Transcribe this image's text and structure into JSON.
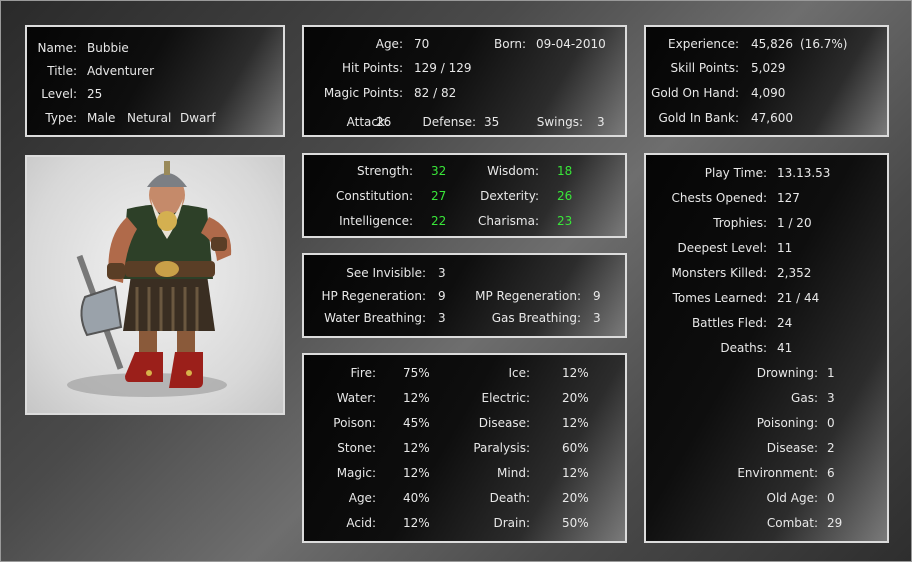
{
  "identity": {
    "name_label": "Name:",
    "name": "Bubbie",
    "title_label": "Title:",
    "title": "Adventurer",
    "level_label": "Level:",
    "level": "25",
    "type_label": "Type:",
    "gender": "Male",
    "alignment": "Netural",
    "race": "Dwarf"
  },
  "vitals": {
    "age_label": "Age:",
    "age": "70",
    "born_label": "Born:",
    "born": "09-04-2010",
    "hp_label": "Hit Points:",
    "hp": "129 / 129",
    "mp_label": "Magic Points:",
    "mp": "82 / 82",
    "attack_label": "Attack:",
    "attack": "26",
    "defense_label": "Defense:",
    "defense": "35",
    "swings_label": "Swings:",
    "swings": "3"
  },
  "wealth": {
    "exp_label": "Experience:",
    "exp": "45,826",
    "exp_pct": "(16.7%)",
    "skill_label": "Skill Points:",
    "skill": "5,029",
    "gold_hand_label": "Gold On Hand:",
    "gold_hand": "4,090",
    "gold_bank_label": "Gold In Bank:",
    "gold_bank": "47,600"
  },
  "attributes": {
    "str_label": "Strength:",
    "str": "32",
    "wis_label": "Wisdom:",
    "wis": "18",
    "con_label": "Constitution:",
    "con": "27",
    "dex_label": "Dexterity:",
    "dex": "26",
    "int_label": "Intelligence:",
    "int": "22",
    "cha_label": "Charisma:",
    "cha": "23"
  },
  "abilities": {
    "see_inv_label": "See Invisible:",
    "see_inv": "3",
    "hp_regen_label": "HP Regeneration:",
    "hp_regen": "9",
    "mp_regen_label": "MP Regeneration:",
    "mp_regen": "9",
    "water_label": "Water Breathing:",
    "water": "3",
    "gas_label": "Gas Breathing:",
    "gas": "3"
  },
  "resistances": {
    "left": [
      {
        "label": "Fire:",
        "value": "75%"
      },
      {
        "label": "Water:",
        "value": "12%"
      },
      {
        "label": "Poison:",
        "value": "45%"
      },
      {
        "label": "Stone:",
        "value": "12%"
      },
      {
        "label": "Magic:",
        "value": "12%"
      },
      {
        "label": "Age:",
        "value": "40%"
      },
      {
        "label": "Acid:",
        "value": "12%"
      }
    ],
    "right": [
      {
        "label": "Ice:",
        "value": "12%"
      },
      {
        "label": "Electric:",
        "value": "20%"
      },
      {
        "label": "Disease:",
        "value": "12%"
      },
      {
        "label": "Paralysis:",
        "value": "60%"
      },
      {
        "label": "Mind:",
        "value": "12%"
      },
      {
        "label": "Death:",
        "value": "20%"
      },
      {
        "label": "Drain:",
        "value": "50%"
      }
    ]
  },
  "statistics": {
    "top": [
      {
        "label": "Play Time:",
        "value": "13.13.53"
      },
      {
        "label": "Chests Opened:",
        "value": "127"
      },
      {
        "label": "Trophies:",
        "value": "1 / 20"
      },
      {
        "label": "Deepest Level:",
        "value": "11"
      },
      {
        "label": "Monsters Killed:",
        "value": "2,352"
      },
      {
        "label": "Tomes Learned:",
        "value": "21 / 44"
      },
      {
        "label": "Battles Fled:",
        "value": "24"
      },
      {
        "label": "Deaths:",
        "value": "41"
      }
    ],
    "deaths": [
      {
        "label": "Drowning:",
        "value": "1"
      },
      {
        "label": "Gas:",
        "value": "3"
      },
      {
        "label": "Poisoning:",
        "value": "0"
      },
      {
        "label": "Disease:",
        "value": "2"
      },
      {
        "label": "Environment:",
        "value": "6"
      },
      {
        "label": "Old Age:",
        "value": "0"
      },
      {
        "label": "Combat:",
        "value": "29"
      }
    ]
  }
}
